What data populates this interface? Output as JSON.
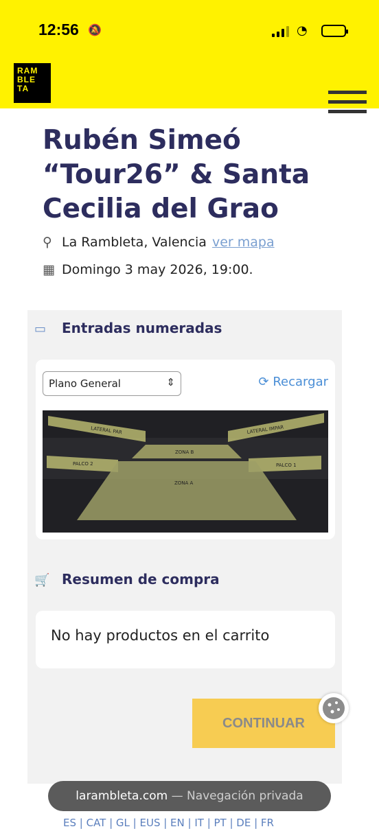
{
  "status_bar": {
    "time": "12:56"
  },
  "header": {
    "logo_lines": [
      "RAM",
      "BLE",
      "TA"
    ]
  },
  "event": {
    "title": "Rubén Simeó “Tour26” & Santa Cecilia del Grao",
    "venue": "La Rambleta, Valencia",
    "map_link": "ver mapa",
    "datetime": "Domingo 3 may 2026, 19:00."
  },
  "tickets": {
    "heading": "Entradas numeradas",
    "plan_select": "Plano General",
    "reload": "Recargar",
    "zones": [
      "LATERAL PAR",
      "LATERAL IMPAR",
      "ZONA B",
      "PALCO 2",
      "PALCO 1",
      "ZONA A"
    ]
  },
  "summary": {
    "heading": "Resumen de compra",
    "empty_message": "No hay productos en el carrito"
  },
  "continue_label": "CONTINUAR",
  "browser": {
    "domain": "larambleta.com",
    "mode": "— Navegación privada"
  },
  "languages": "ES | CAT | GL | EUS | EN | IT | PT | DE | FR",
  "colors": {
    "brand_yellow": "#fff200",
    "title_navy": "#2d2d5e",
    "button": "#f7cc52",
    "link": "#7a9fd0"
  }
}
